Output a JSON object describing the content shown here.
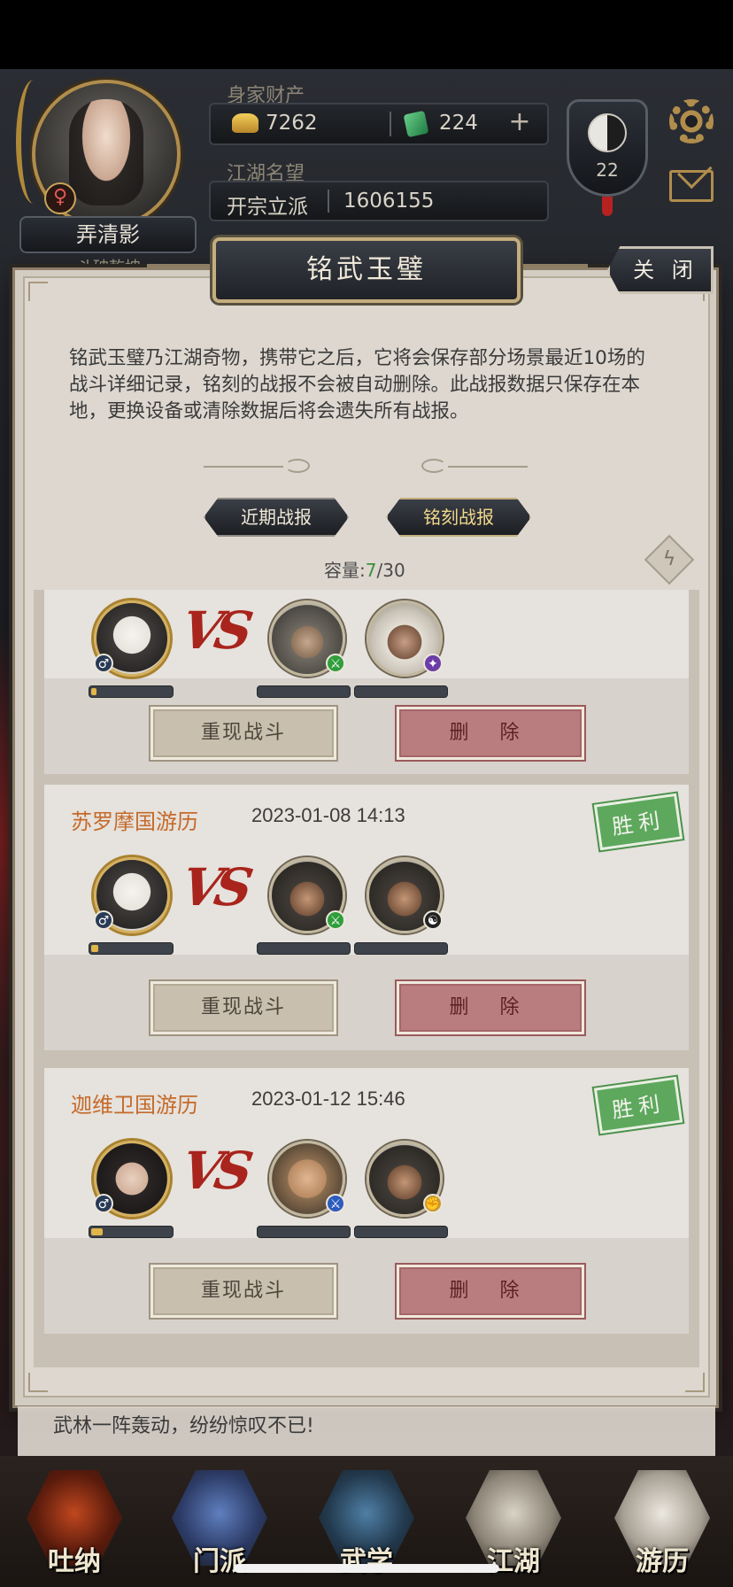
{
  "player": {
    "name": "弄清影",
    "subtitle": "斗破乾坤",
    "gender_icon": "female-symbol-icon",
    "level": "22",
    "assets_label": "身家财产",
    "gold": "7262",
    "jade": "224",
    "fame_label": "江湖名望",
    "fame_rank": "开宗立派",
    "fame_value": "1606155"
  },
  "modal": {
    "title": "铭武玉璧",
    "close_label": "关 闭",
    "description": "铭武玉璧乃江湖奇物，携带它之后，它将会保存部分场景最近10场的战斗详细记录，铭刻的战报不会被自动删除。此战报数据只保存在本地，更换设备或清除数据后将会遗失所有战报。",
    "tabs": [
      {
        "label": "近期战报",
        "active": false
      },
      {
        "label": "铭刻战报",
        "active": true
      }
    ],
    "capacity_label": "容量:",
    "capacity_used": "7",
    "capacity_total": "/30"
  },
  "records": [
    {
      "title": "",
      "date": "",
      "result": "",
      "hero": {
        "portrait": "masked-hero",
        "badge": "male-icon",
        "hp": 0.07
      },
      "enemies": [
        {
          "portrait": "helmet-warrior",
          "badge": "green-sword-icon",
          "hp": 0
        },
        {
          "portrait": "turban-warrior",
          "badge": "purple-staff-icon",
          "hp": 0
        }
      ],
      "replay_label": "重现战斗",
      "delete_label": "删 除"
    },
    {
      "title": "苏罗摩国游历",
      "date": "2023-01-08 14:13",
      "result": "胜利",
      "hero": {
        "portrait": "masked-hero",
        "badge": "male-icon",
        "hp": 0.09
      },
      "enemies": [
        {
          "portrait": "blade-rogue",
          "badge": "green-sword-icon",
          "hp": 0
        },
        {
          "portrait": "bearded-fighter",
          "badge": "yinyang-icon",
          "hp": 0
        }
      ],
      "replay_label": "重现战斗",
      "delete_label": "删 除"
    },
    {
      "title": "迦维卫国游历",
      "date": "2023-01-12 15:46",
      "result": "胜利",
      "hero": {
        "portrait": "lady-hero",
        "badge": "male-icon",
        "hp": 0.14
      },
      "enemies": [
        {
          "portrait": "bald-monk",
          "badge": "blue-blade-icon",
          "hp": 0
        },
        {
          "portrait": "bearded-fighter",
          "badge": "gold-fist-icon",
          "hp": 0
        }
      ],
      "replay_label": "重现战斗",
      "delete_label": "删 除"
    }
  ],
  "vs_label": "VS",
  "news": "武林一阵轰动，纷纷惊叹不已!",
  "nav": [
    {
      "label": "吐纳"
    },
    {
      "label": "门派"
    },
    {
      "label": "武学"
    },
    {
      "label": "江湖"
    },
    {
      "label": "游历"
    }
  ],
  "colors": {
    "accent_orange": "#c46a2a",
    "win_green": "#5da85d",
    "delete_red": "#b97d7f",
    "vs_red": "#a8241c"
  }
}
